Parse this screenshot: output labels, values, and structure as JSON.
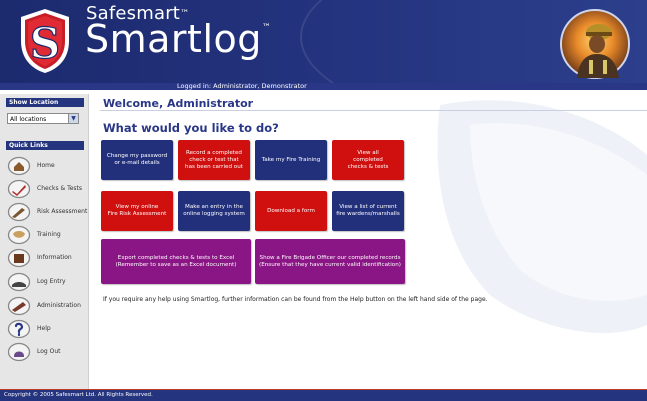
{
  "header": {
    "brand_top": "Safesmart",
    "brand_main": "Smartlog",
    "trademark": "™",
    "logo_letter": "S",
    "logged_in": "Logged in: Administrator, Demonstrator"
  },
  "sidebar": {
    "location_heading": "Show Location",
    "location_value": "All locations",
    "quick_links_heading": "Quick Links",
    "links": [
      {
        "label": "Home",
        "icon": "home-icon"
      },
      {
        "label": "Checks & Tests",
        "icon": "checks-tests-icon"
      },
      {
        "label": "Risk Assessment",
        "icon": "risk-assessment-icon"
      },
      {
        "label": "Training",
        "icon": "training-icon"
      },
      {
        "label": "Information",
        "icon": "information-icon"
      },
      {
        "label": "Log Entry",
        "icon": "log-entry-icon"
      },
      {
        "label": "Administration",
        "icon": "administration-icon"
      },
      {
        "label": "Help",
        "icon": "help-icon"
      },
      {
        "label": "Log Out",
        "icon": "log-out-icon"
      }
    ]
  },
  "main": {
    "welcome": "Welcome, Administrator",
    "question": "What would you like to do?",
    "tiles": [
      {
        "lines": [
          "Change my password",
          "or e-mail details"
        ],
        "color": "#22307c"
      },
      {
        "lines": [
          "Record a completed",
          "check or test that",
          "has been carried out"
        ],
        "color": "#d00f0f"
      },
      {
        "lines": [
          "Take my Fire Training"
        ],
        "color": "#22307c"
      },
      {
        "lines": [
          "View all",
          "completed",
          "checks & tests"
        ],
        "color": "#d00f0f"
      },
      {
        "lines": [
          "View my online",
          "Fire Risk Assessment"
        ],
        "color": "#d00f0f"
      },
      {
        "lines": [
          "Make an entry in the",
          "online logging system"
        ],
        "color": "#22307c"
      },
      {
        "lines": [
          "Download a form"
        ],
        "color": "#d00f0f"
      },
      {
        "lines": [
          "View a list of current",
          "fire wardens/marshalls"
        ],
        "color": "#22307c"
      },
      {
        "lines": [
          "Export completed checks & tests to Excel",
          "(Remember to save as an Excel document)"
        ],
        "color": "#8a1584"
      },
      {
        "lines": [
          "Show a Fire Brigade Officer our completed records",
          "(Ensure that they have current valid identification)"
        ],
        "color": "#8a1584"
      }
    ],
    "help_text": "If you require any help using Smartlog, further information can be found from the Help button on the left hand side of the page."
  },
  "footer": {
    "copyright": "Copyright © 2005 Safesmart Ltd. All Rights Reserved."
  }
}
